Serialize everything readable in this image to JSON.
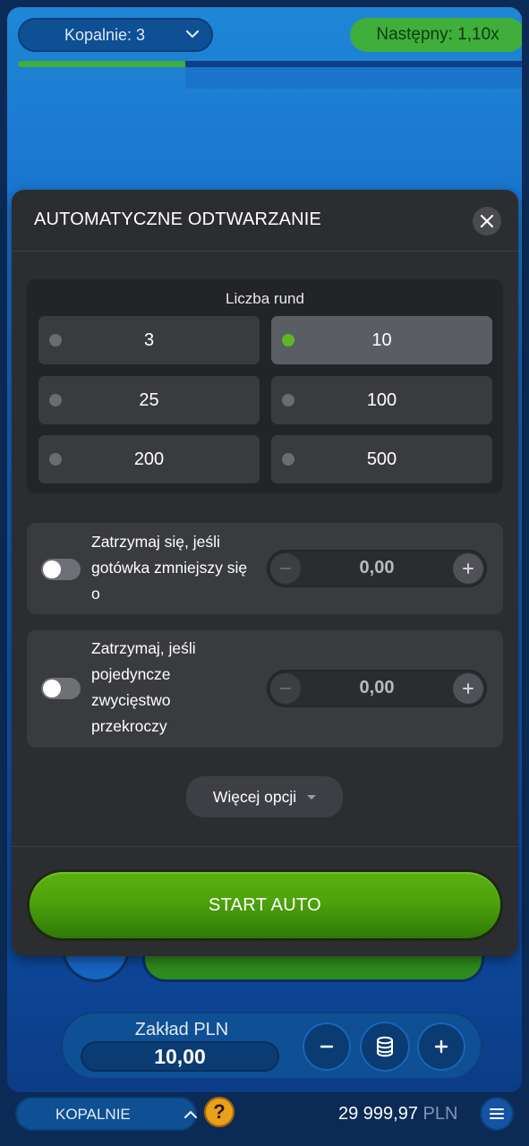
{
  "header": {
    "mines_select": "Kopalnie: 3",
    "next_multiplier": "Następny: 1,10x",
    "progress_fraction": 0.33
  },
  "modal": {
    "title": "AUTOMATYCZNE ODTWARZANIE",
    "rounds_title": "Liczba rund",
    "rounds": [
      {
        "label": "3",
        "selected": false
      },
      {
        "label": "10",
        "selected": true
      },
      {
        "label": "25",
        "selected": false
      },
      {
        "label": "100",
        "selected": false
      },
      {
        "label": "200",
        "selected": false
      },
      {
        "label": "500",
        "selected": false
      }
    ],
    "stop_loss": {
      "line1": "Zatrzymaj się, jeśli",
      "line2": "gotówka zmniejszy się",
      "line3": "o",
      "value": "0,00",
      "enabled": false
    },
    "stop_win": {
      "line1": "Zatrzymaj, jeśli",
      "line2": "pojedyncze",
      "line3": "zwycięstwo",
      "line4": "przekroczy",
      "value": "0,00",
      "enabled": false
    },
    "more_options": "Więcej opcji",
    "start_button": "START AUTO"
  },
  "bet": {
    "label": "Zakład PLN",
    "value": "10,00"
  },
  "footer": {
    "game_select": "KOPALNIE",
    "help_icon": "?",
    "balance_amount": "29 999,97",
    "balance_currency": "PLN"
  },
  "colors": {
    "accent_green": "#4ea20b",
    "badge_green": "#3fae3b",
    "modal_bg": "#2c2d30",
    "help_orange": "#e9a01a"
  }
}
